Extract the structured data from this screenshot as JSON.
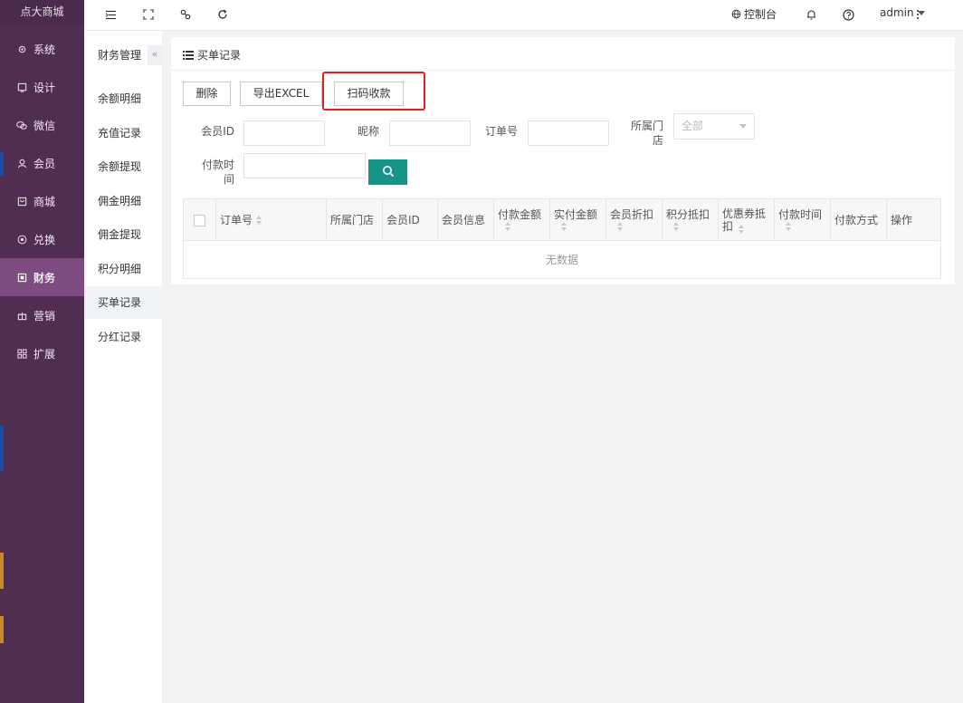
{
  "app": {
    "brand": "点大商城"
  },
  "sidebar": {
    "items": [
      {
        "label": "系统",
        "icon": "gear-icon"
      },
      {
        "label": "设计",
        "icon": "monitor-icon"
      },
      {
        "label": "微信",
        "icon": "wechat-icon"
      },
      {
        "label": "会员",
        "icon": "user-icon"
      },
      {
        "label": "商城",
        "icon": "shop-icon"
      },
      {
        "label": "兑换",
        "icon": "exchange-icon"
      },
      {
        "label": "财务",
        "icon": "finance-icon",
        "active": true
      },
      {
        "label": "营销",
        "icon": "gift-icon"
      },
      {
        "label": "扩展",
        "icon": "grid-icon"
      }
    ]
  },
  "submenu": {
    "title": "财务管理",
    "items": [
      {
        "label": "余额明细"
      },
      {
        "label": "充值记录"
      },
      {
        "label": "余额提现"
      },
      {
        "label": "佣金明细"
      },
      {
        "label": "佣金提现"
      },
      {
        "label": "积分明细"
      },
      {
        "label": "买单记录",
        "active": true
      },
      {
        "label": "分红记录"
      }
    ]
  },
  "topbar": {
    "console_label": "控制台",
    "user_label": "admin"
  },
  "page": {
    "title": "买单记录",
    "buttons": {
      "delete": "删除",
      "export": "导出EXCEL",
      "scan_pay": "扫码收款"
    },
    "filters": {
      "member_id_label": "会员ID",
      "nickname_label": "昵称",
      "order_no_label": "订单号",
      "store_label": "所属门店",
      "store_value": "全部",
      "pay_time_label": "付款时间"
    }
  },
  "table": {
    "columns": [
      {
        "label": "订单号",
        "sortable": true
      },
      {
        "label": "所属门店",
        "sortable": false
      },
      {
        "label": "会员ID",
        "sortable": false
      },
      {
        "label": "会员信息",
        "sortable": false
      },
      {
        "label": "付款金额",
        "sortable": true
      },
      {
        "label": "实付金额",
        "sortable": true
      },
      {
        "label": "会员折扣",
        "sortable": true
      },
      {
        "label": "积分抵扣",
        "sortable": true
      },
      {
        "label": "优惠券抵扣",
        "sortable": true
      },
      {
        "label": "付款时间",
        "sortable": true
      },
      {
        "label": "付款方式",
        "sortable": false
      },
      {
        "label": "操作",
        "sortable": false
      }
    ],
    "empty_text": "无数据"
  },
  "colors": {
    "sidebar_bg": "#4f2e52",
    "sidebar_active": "#7d4b80",
    "search_button": "#159488",
    "highlight_border": "#e02020"
  }
}
